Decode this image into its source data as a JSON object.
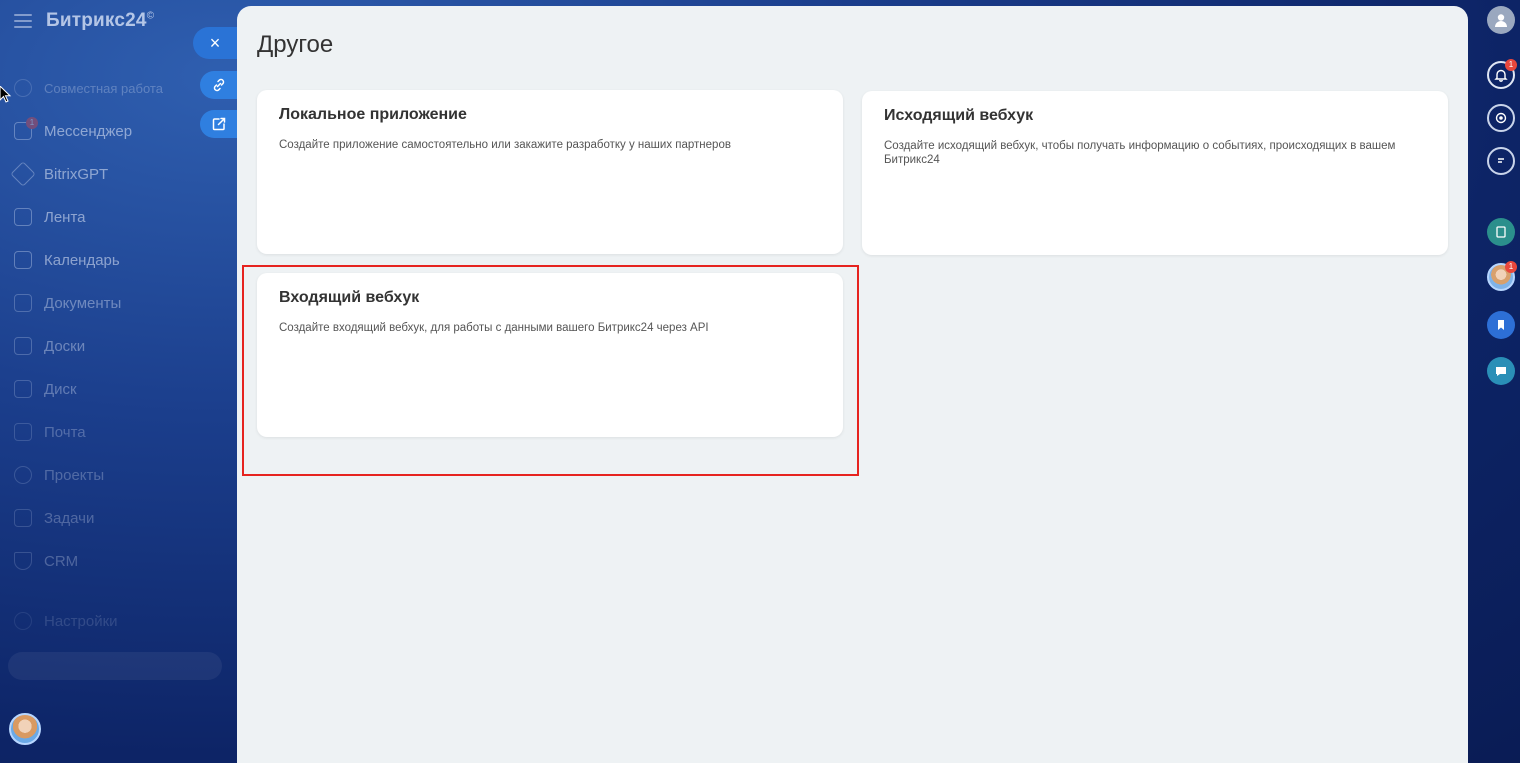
{
  "app": {
    "brand": "Битрикс24",
    "brand_mark": "©"
  },
  "sidebar": {
    "items": [
      {
        "label": "Совместная работа",
        "icon": "collab-icon"
      },
      {
        "label": "Мессенджер",
        "icon": "chat-icon",
        "badge": "1"
      },
      {
        "label": "BitrixGPT",
        "icon": "ai-icon"
      },
      {
        "label": "Лента",
        "icon": "feed-icon"
      },
      {
        "label": "Календарь",
        "icon": "calendar-icon"
      },
      {
        "label": "Документы",
        "icon": "document-icon"
      },
      {
        "label": "Доски",
        "icon": "board-icon"
      },
      {
        "label": "Диск",
        "icon": "disk-icon"
      },
      {
        "label": "Почта",
        "icon": "mail-icon"
      },
      {
        "label": "Проекты",
        "icon": "projects-icon"
      },
      {
        "label": "Задачи",
        "icon": "tasks-icon"
      },
      {
        "label": "CRM",
        "icon": "crm-icon"
      },
      {
        "label": "Настройки",
        "icon": "settings-icon"
      }
    ]
  },
  "panel": {
    "title": "Другое",
    "cards": [
      {
        "title": "Локальное приложение",
        "description": "Создайте приложение самостоятельно или закажите разработку у наших партнеров"
      },
      {
        "title": "Исходящий вебхук",
        "description": "Создайте исходящий вебхук, чтобы получать информацию о событиях, происходящих в вашем Битрикс24"
      },
      {
        "title": "Входящий вебхук",
        "description": "Создайте входящий вебхук, для работы с данными вашего Битрикс24 через API"
      }
    ]
  },
  "panel_controls": {
    "close": "×"
  },
  "rightbar": {
    "bell_badge": "1",
    "avatar_badge": "1"
  },
  "colors": {
    "highlight": "#e6231f",
    "accent": "#2f7fe0",
    "panel_bg": "#eef2f4"
  }
}
